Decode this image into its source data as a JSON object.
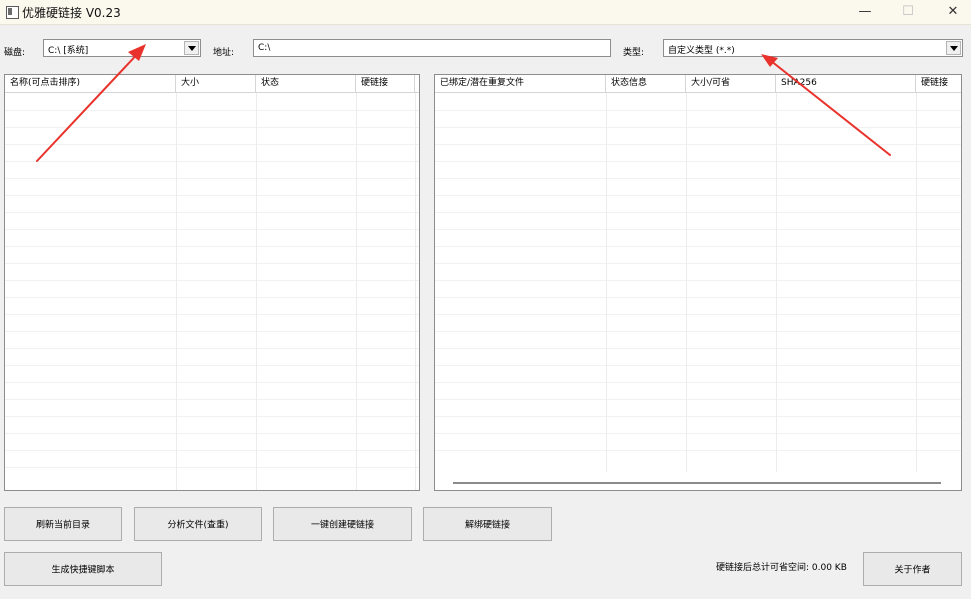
{
  "window": {
    "title": "优雅硬链接 V0.23",
    "controls": [
      "—",
      "☐",
      "✕"
    ]
  },
  "toolbar": {
    "disk_label": "磁盘:",
    "disk_value": "C:\\ [系统]",
    "address_label": "地址:",
    "address_value": "C:\\",
    "type_label": "类型:",
    "type_value": "自定义类型 (*.*)"
  },
  "left_list": {
    "columns": [
      "名称(可点击排序)",
      "大小",
      "状态",
      "硬链接"
    ]
  },
  "right_list": {
    "columns": [
      "已绑定/潜在重复文件",
      "状态信息",
      "大小/可省",
      "SHA256",
      "硬链接"
    ]
  },
  "buttons": {
    "refresh": "刷新当前目录",
    "analyze": "分析文件(查重)",
    "create_links": "一键创建硬链接",
    "unlink": "解绑硬链接",
    "generate_script": "生成快捷键脚本",
    "about": "关于作者"
  },
  "status": {
    "savings": "硬链接后总计可省空间: 0.00 KB"
  },
  "colors": {
    "annotation_arrow": "#e8322b",
    "titlebar_bg": "#fbf8ee",
    "window_bg": "#f0f0f0"
  }
}
